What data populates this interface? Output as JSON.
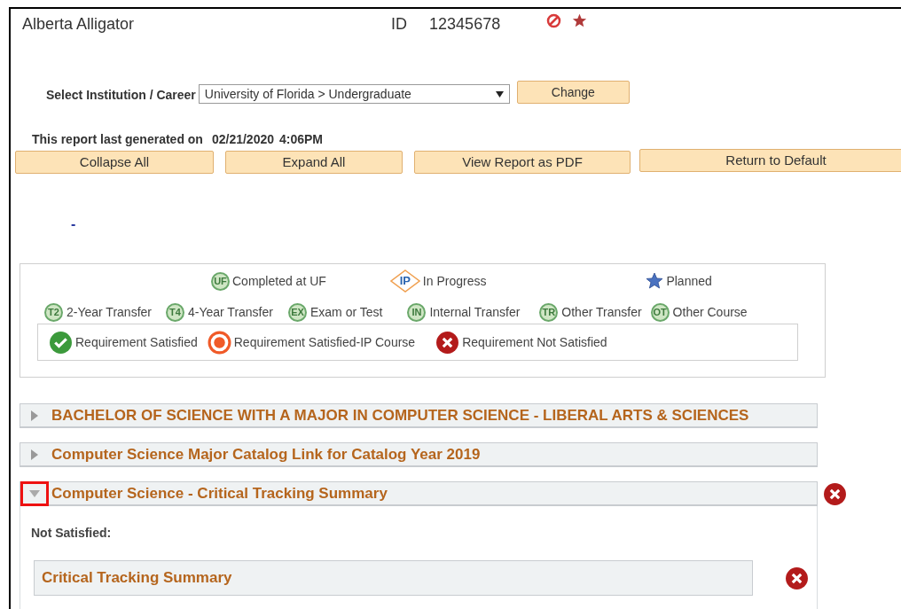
{
  "student": {
    "name": "Alberta Alligator",
    "id_label": "ID",
    "id": "12345678"
  },
  "institution": {
    "label": "Select Institution / Career",
    "value": "University of Florida > Undergraduate",
    "button": "Change"
  },
  "report": {
    "label": "This report last generated on",
    "date": "02/21/2020",
    "time": "4:06PM"
  },
  "buttons": [
    "Collapse All",
    "Expand All",
    "View Report as PDF",
    "Return to Default"
  ],
  "dash": "-",
  "legend": {
    "course_types": [
      {
        "kind": "circle",
        "badge": "UF",
        "label": "Completed at UF"
      },
      {
        "kind": "diamond",
        "badge": "IP",
        "label": "In Progress"
      },
      {
        "kind": "star",
        "label": "Planned"
      }
    ],
    "sources": [
      {
        "badge": "T2",
        "label": "2-Year Transfer"
      },
      {
        "badge": "T4",
        "label": "4-Year Transfer"
      },
      {
        "badge": "EX",
        "label": "Exam or Test"
      },
      {
        "badge": "IN",
        "label": "Internal Transfer"
      },
      {
        "badge": "TR",
        "label": "Other Transfer"
      },
      {
        "badge": "OT",
        "label": "Other Course"
      }
    ],
    "statuses": [
      {
        "kind": "satisfied",
        "label": "Requirement Satisfied"
      },
      {
        "kind": "in_progress",
        "label": "Requirement Satisfied-IP Course"
      },
      {
        "kind": "not_satisfied",
        "label": "Requirement Not Satisfied"
      }
    ]
  },
  "sections": [
    {
      "title": "BACHELOR OF SCIENCE WITH A MAJOR IN COMPUTER SCIENCE - LIBERAL ARTS & SCIENCES",
      "expanded": false,
      "highlighted": false
    },
    {
      "title": "Computer Science Major Catalog Link for Catalog Year 2019",
      "expanded": false,
      "highlighted": false
    },
    {
      "title": "Computer Science - Critical Tracking Summary",
      "expanded": true,
      "highlighted": true,
      "satisfied": false,
      "note": "Not Satisfied:",
      "subsections": [
        {
          "title": "Critical Tracking Summary",
          "satisfied": false
        }
      ]
    }
  ]
}
